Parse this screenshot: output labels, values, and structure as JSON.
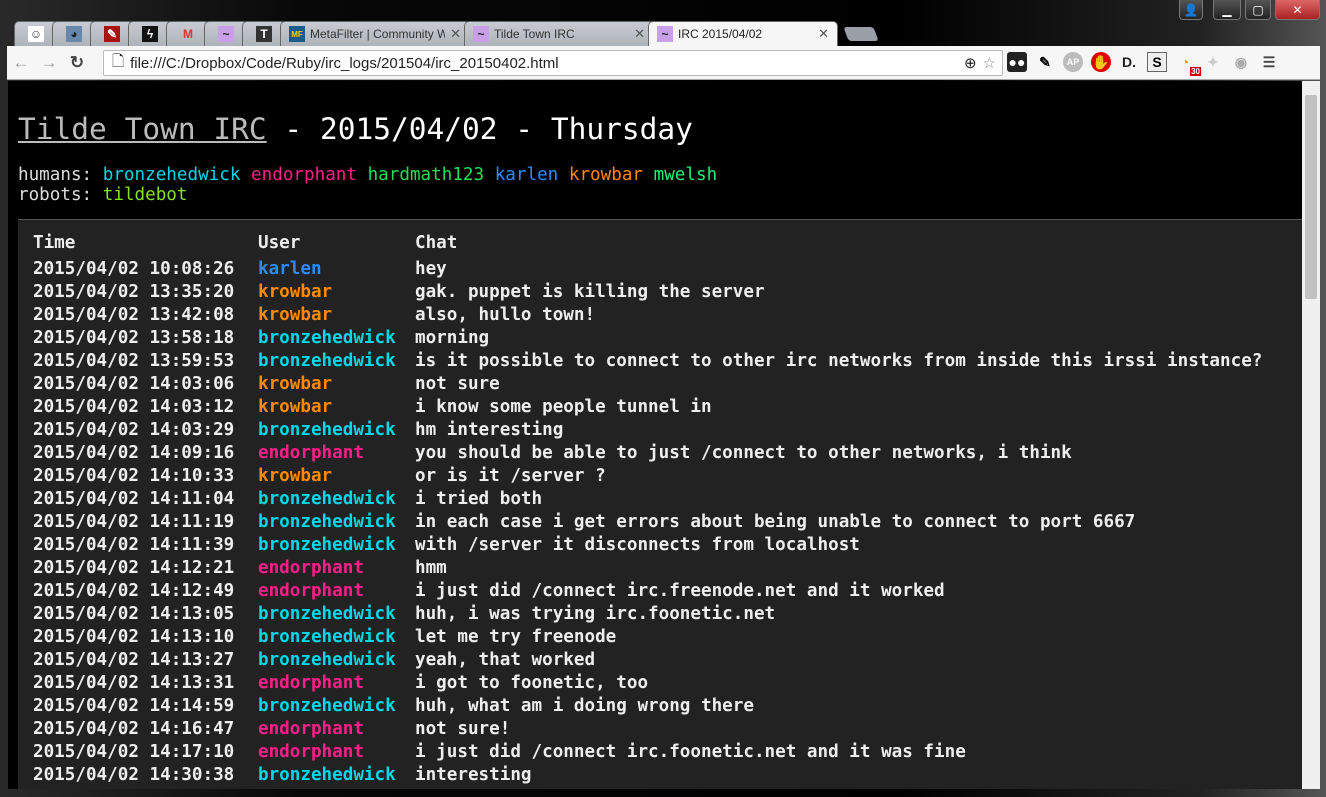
{
  "browser": {
    "tabs": [
      {
        "icon": "reddit-alien-icon",
        "pinned": true
      },
      {
        "icon": "avatar-favicon-icon",
        "pinned": true
      },
      {
        "icon": "pushpin-red-icon",
        "pinned": true
      },
      {
        "icon": "bolt-favicon-icon",
        "pinned": true
      },
      {
        "icon": "gmail-icon",
        "pinned": true
      },
      {
        "icon": "tilde-icon",
        "pinned": true
      },
      {
        "icon": "t-favicon-icon",
        "pinned": true
      },
      {
        "icon": "metafilter-icon",
        "title": "MetaFilter | Community W"
      },
      {
        "icon": "tilde-icon",
        "title": "Tilde Town IRC"
      },
      {
        "icon": "tilde-icon",
        "title": "IRC 2015/04/02",
        "active": true
      }
    ],
    "url": "file:///C:/Dropbox/Code/Ruby/irc_logs/201504/irc_20150402.html",
    "rss_badge": "30"
  },
  "page": {
    "title_link": "Tilde Town IRC",
    "title_rest": " - 2015/04/02 - Thursday",
    "humans_label": "humans:",
    "robots_label": "robots:",
    "humans": [
      {
        "name": "bronzehedwick",
        "color": "#00d7e8"
      },
      {
        "name": "endorphant",
        "color": "#ff1f8a"
      },
      {
        "name": "hardmath123",
        "color": "#22dd55"
      },
      {
        "name": "karlen",
        "color": "#2a8cff"
      },
      {
        "name": "krowbar",
        "color": "#ff8a00"
      },
      {
        "name": "mwelsh",
        "color": "#22ee77"
      }
    ],
    "robots": [
      {
        "name": "tildebot",
        "color": "#88e020"
      }
    ],
    "headers": {
      "time": "Time",
      "user": "User",
      "chat": "Chat"
    },
    "rows": [
      [
        "2015/04/02 10:08:26",
        "karlen",
        "hey"
      ],
      [
        "2015/04/02 13:35:20",
        "krowbar",
        "gak. puppet is killing the server"
      ],
      [
        "2015/04/02 13:42:08",
        "krowbar",
        "also, hullo town!"
      ],
      [
        "2015/04/02 13:58:18",
        "bronzehedwick",
        "morning"
      ],
      [
        "2015/04/02 13:59:53",
        "bronzehedwick",
        "is it possible to connect to other irc networks from inside this irssi instance?"
      ],
      [
        "2015/04/02 14:03:06",
        "krowbar",
        "not sure"
      ],
      [
        "2015/04/02 14:03:12",
        "krowbar",
        "i know some people tunnel in"
      ],
      [
        "2015/04/02 14:03:29",
        "bronzehedwick",
        "hm interesting"
      ],
      [
        "2015/04/02 14:09:16",
        "endorphant",
        "you should be able to just /connect to other networks, i think"
      ],
      [
        "2015/04/02 14:10:33",
        "krowbar",
        "or is it /server ?"
      ],
      [
        "2015/04/02 14:11:04",
        "bronzehedwick",
        "i tried both"
      ],
      [
        "2015/04/02 14:11:19",
        "bronzehedwick",
        "in each case i get errors about being unable to connect to port 6667"
      ],
      [
        "2015/04/02 14:11:39",
        "bronzehedwick",
        "with /server it disconnects from localhost"
      ],
      [
        "2015/04/02 14:12:21",
        "endorphant",
        "hmm"
      ],
      [
        "2015/04/02 14:12:49",
        "endorphant",
        "i just did /connect irc.freenode.net and it worked"
      ],
      [
        "2015/04/02 14:13:05",
        "bronzehedwick",
        "huh, i was trying irc.foonetic.net"
      ],
      [
        "2015/04/02 14:13:10",
        "bronzehedwick",
        "let me try freenode"
      ],
      [
        "2015/04/02 14:13:27",
        "bronzehedwick",
        "yeah, that worked"
      ],
      [
        "2015/04/02 14:13:31",
        "endorphant",
        "i got to foonetic, too"
      ],
      [
        "2015/04/02 14:14:59",
        "bronzehedwick",
        "huh, what am i doing wrong there"
      ],
      [
        "2015/04/02 14:16:47",
        "endorphant",
        "not sure!"
      ],
      [
        "2015/04/02 14:17:10",
        "endorphant",
        "i just did /connect irc.foonetic.net and it was fine"
      ],
      [
        "2015/04/02 14:30:38",
        "bronzehedwick",
        "interesting"
      ]
    ]
  }
}
